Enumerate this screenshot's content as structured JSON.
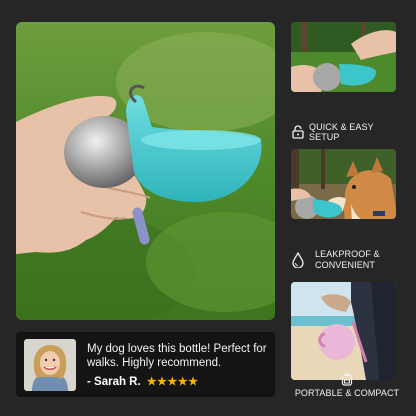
{
  "features": [
    {
      "label": "QUICK & EASY SETUP",
      "icon": "unlock-icon"
    },
    {
      "label_line1": "LEAKPROOF &",
      "label_line2": "CONVENIENT",
      "icon": "water-drop-icon"
    },
    {
      "label": "PORTABLE & COMPACT",
      "icon": "backpack-icon"
    }
  ],
  "review": {
    "quote": "My dog loves this bottle! Perfect for walks. Highly recommend.",
    "author": "- Sarah R.",
    "stars": "★★★★★"
  },
  "colors": {
    "background": "#262626",
    "review_card": "#141414",
    "bowl_teal": "#3cc6cc",
    "star_gold": "#f5b400",
    "grass_green": "#4f8a2a"
  }
}
